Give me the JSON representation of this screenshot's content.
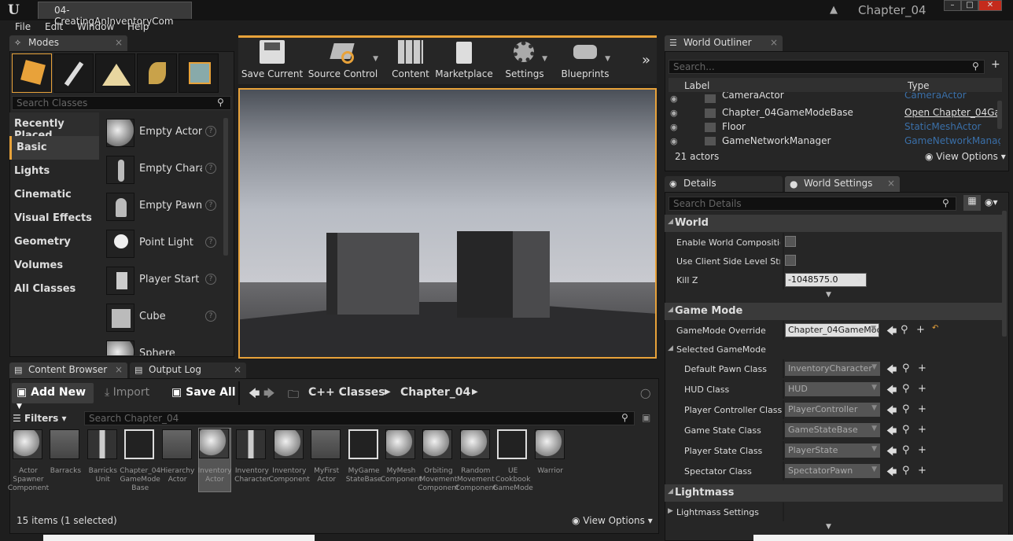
{
  "window": {
    "tab_title": "04-CreatingAnInventoryCom",
    "project_name": "Chapter_04",
    "logo": "U"
  },
  "menu": [
    "File",
    "Edit",
    "Window",
    "Help"
  ],
  "modes": {
    "tab_label": "Modes",
    "search_placeholder": "Search Classes",
    "categories": [
      "Recently Placed",
      "Basic",
      "Lights",
      "Cinematic",
      "Visual Effects",
      "Geometry",
      "Volumes",
      "All Classes"
    ],
    "selected_category": "Basic",
    "assets": [
      "Empty Actor",
      "Empty Charac",
      "Empty Pawn",
      "Point Light",
      "Player Start",
      "Cube",
      "Sphere"
    ]
  },
  "toolbar": [
    {
      "label": "Save Current",
      "icon": "save-icon"
    },
    {
      "label": "Source Control",
      "icon": "source-control-icon"
    },
    {
      "label": "Content",
      "icon": "content-icon"
    },
    {
      "label": "Marketplace",
      "icon": "marketplace-icon"
    },
    {
      "label": "Settings",
      "icon": "settings-icon"
    },
    {
      "label": "Blueprints",
      "icon": "blueprints-icon"
    }
  ],
  "outliner": {
    "tab_label": "World Outliner",
    "search_placeholder": "Search...",
    "col_label": "Label",
    "col_type": "Type",
    "rows": [
      {
        "name": "CameraActor",
        "type": "CameraActor"
      },
      {
        "name": "Chapter_04GameModeBase",
        "type": "Open Chapter_04Ga"
      },
      {
        "name": "Floor",
        "type": "StaticMeshActor"
      },
      {
        "name": "GameNetworkManager",
        "type": "GameNetworkManag"
      }
    ],
    "count": "21 actors",
    "view_options": "View Options"
  },
  "details": {
    "tab_details": "Details",
    "tab_world": "World Settings",
    "search_placeholder": "Search Details",
    "world_section": "World",
    "enable_world_composition": "Enable World Composition",
    "use_client_side": "Use Client Side Level Strea",
    "kill_z_label": "Kill Z",
    "kill_z_value": "-1048575.0",
    "game_mode_section": "Game Mode",
    "gamemode_override_label": "GameMode Override",
    "gamemode_override_value": "Chapter_04GameMoc",
    "selected_gamemode": "Selected GameMode",
    "classes": [
      {
        "label": "Default Pawn Class",
        "value": "InventoryCharacter"
      },
      {
        "label": "HUD Class",
        "value": "HUD"
      },
      {
        "label": "Player Controller Class",
        "value": "PlayerController"
      },
      {
        "label": "Game State Class",
        "value": "GameStateBase"
      },
      {
        "label": "Player State Class",
        "value": "PlayerState"
      },
      {
        "label": "Spectator Class",
        "value": "SpectatorPawn"
      }
    ],
    "lightmass_section": "Lightmass",
    "lightmass_settings": "Lightmass Settings"
  },
  "content": {
    "tab_label": "Content Browser",
    "output_tab": "Output Log",
    "add_new": "Add New",
    "import": "Import",
    "save_all": "Save All",
    "path": [
      "C++ Classes",
      "Chapter_04"
    ],
    "filters": "Filters",
    "search_placeholder": "Search Chapter_04",
    "items": [
      "Actor Spawner Component",
      "Barracks",
      "Barricks Unit",
      "Chapter_04 GameMode Base",
      "Hierarchy Actor",
      "Inventory Actor",
      "Inventory Character",
      "Inventory Component",
      "MyFirst Actor",
      "MyGame StateBase",
      "MyMesh Component",
      "Orbiting Movement Component",
      "Random Movement Component",
      "UE Cookbook GameMode",
      "Warrior"
    ],
    "selected_item": "Inventory Actor",
    "status": "15 items (1 selected)",
    "view_options": "View Options"
  },
  "colors": {
    "accent": "#e8a23a",
    "link": "#3a6fa8",
    "panel": "#262626"
  }
}
